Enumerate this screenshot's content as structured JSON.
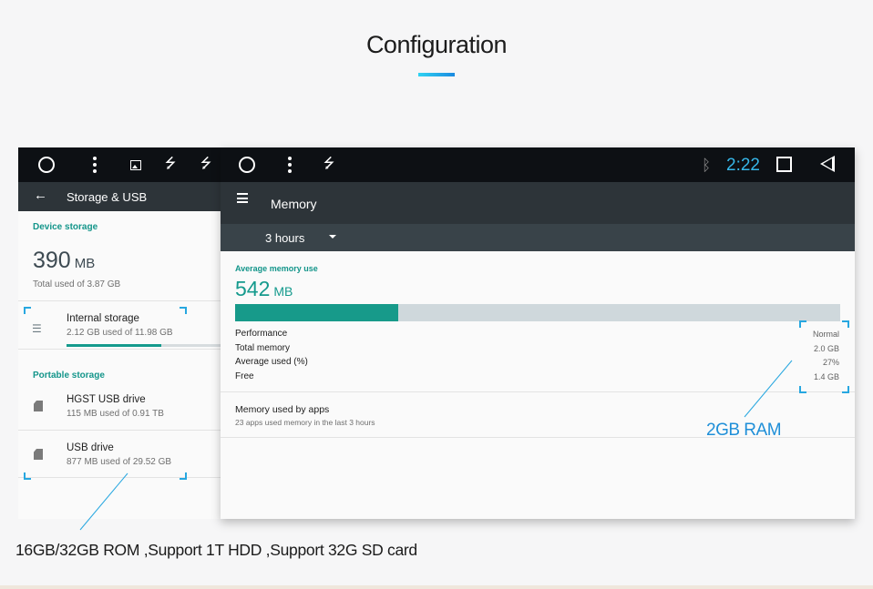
{
  "header": {
    "title": "Configuration"
  },
  "storage_screen": {
    "title": "Storage & USB",
    "device_storage": {
      "heading": "Device storage",
      "used_value": "390",
      "used_unit": "MB",
      "total_text": "Total used of 3.87 GB"
    },
    "internal": {
      "title": "Internal storage",
      "detail": "2.12 GB used of 11.98 GB",
      "progress": 0.177
    },
    "portable_heading": "Portable storage",
    "drives": [
      {
        "title": "HGST USB drive",
        "detail": "115 MB used of 0.91 TB"
      },
      {
        "title": "USB drive",
        "detail": "877 MB used of 29.52 GB"
      }
    ]
  },
  "memory_screen": {
    "title": "Memory",
    "period": "3 hours",
    "status_time": "2:22",
    "avg_heading": "Average memory use",
    "avg_value": "542",
    "avg_unit": "MB",
    "usage_fraction": 0.27,
    "stats": [
      {
        "label": "Performance",
        "value": "Normal"
      },
      {
        "label": "Total memory",
        "value": "2.0 GB"
      },
      {
        "label": "Average used (%)",
        "value": "27%"
      },
      {
        "label": "Free",
        "value": "1.4 GB"
      }
    ],
    "apps": {
      "title": "Memory used by apps",
      "detail": "23 apps used memory in the last 3 hours"
    }
  },
  "callouts": {
    "ram": "2GB RAM",
    "rom": "16GB/32GB ROM ,Support 1T HDD ,Support 32G SD card"
  },
  "colors": {
    "accent_teal": "#159a8d",
    "callout_blue": "#1f8fd8",
    "clock_blue": "#37b7e9",
    "appbar": "#2d3439"
  },
  "icons": [
    "home-circle-icon",
    "menu-dots-icon",
    "image-icon",
    "usb-icon",
    "back-arrow-icon",
    "storage-list-icon",
    "sd-card-icon",
    "hamburger-menu-icon",
    "dropdown-caret-icon",
    "bluetooth-icon",
    "recents-square-icon",
    "nav-back-icon"
  ]
}
